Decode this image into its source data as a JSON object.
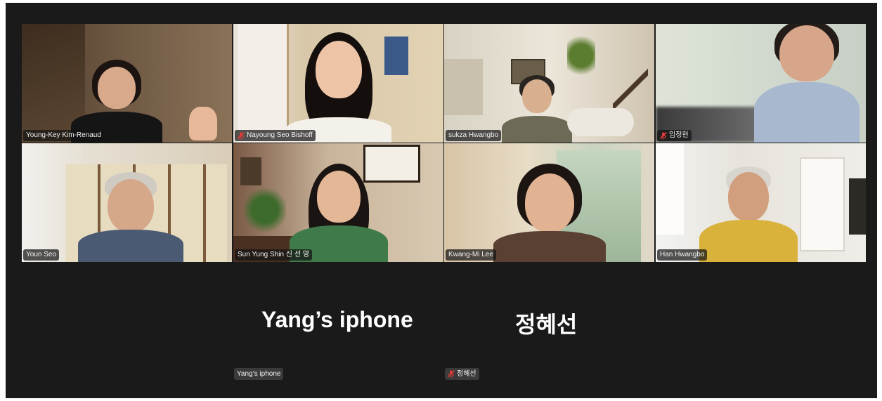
{
  "participants": [
    {
      "name": "Young-Key Kim-Renaud",
      "muted": false,
      "active": false
    },
    {
      "name": "Nayoung Seo Bishoff",
      "muted": true,
      "active": false
    },
    {
      "name": "sukza Hwangbo",
      "muted": false,
      "active": false
    },
    {
      "name": "임정현",
      "muted": true,
      "active": false
    },
    {
      "name": "Youn Seo",
      "muted": false,
      "active": false
    },
    {
      "name": "Sun Yung Shin 신 선 영",
      "muted": false,
      "active": false
    },
    {
      "name": "Kwang-Mi Lee",
      "muted": false,
      "active": true
    },
    {
      "name": "Han Hwangbo",
      "muted": false,
      "active": false
    }
  ],
  "no_video": [
    {
      "display_name": "Yang’s iphone",
      "tag": "Yang’s iphone",
      "muted": false
    },
    {
      "display_name": "정혜선",
      "tag": "정혜선",
      "muted": true
    }
  ],
  "icons": {
    "mute": "mic-muted-icon"
  },
  "colors": {
    "background": "#1a1a1a",
    "active_speaker_border": "#2ecc71",
    "mute_icon": "#e03b3b"
  }
}
